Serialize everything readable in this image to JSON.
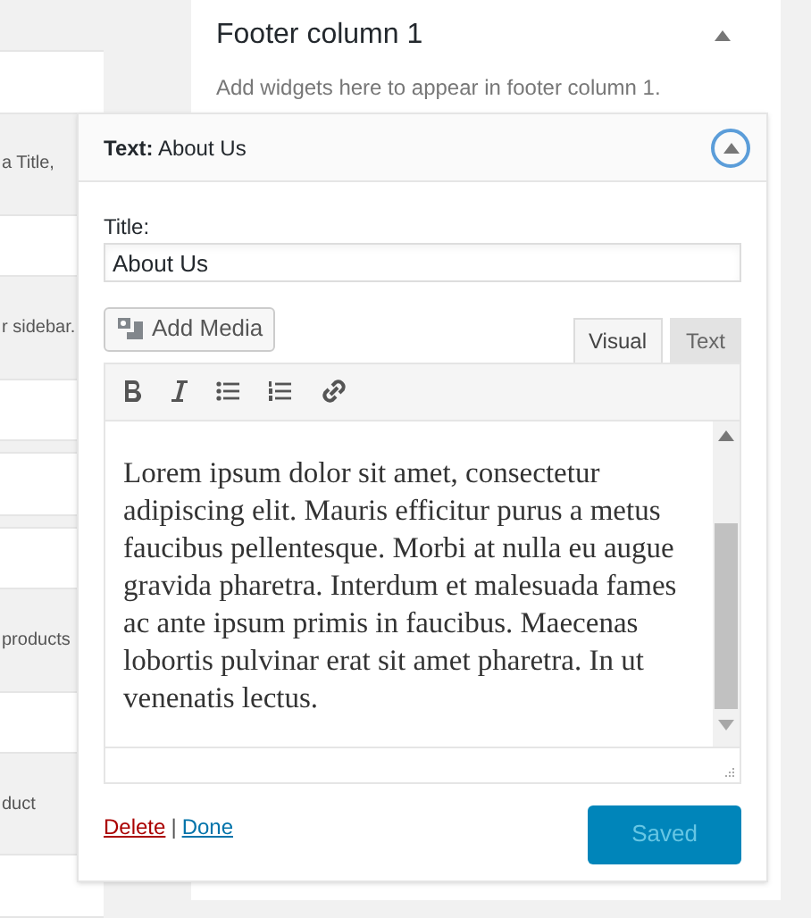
{
  "left_column": {
    "items": [
      {
        "kind": "blank"
      },
      {
        "kind": "text",
        "text": "a Title,"
      },
      {
        "kind": "blank"
      },
      {
        "kind": "text",
        "text": "r sidebar."
      },
      {
        "kind": "blank"
      },
      {
        "kind": "blank"
      },
      {
        "kind": "blank"
      },
      {
        "kind": "text",
        "text": "products"
      },
      {
        "kind": "blank"
      },
      {
        "kind": "text",
        "text": "duct"
      },
      {
        "kind": "blank"
      }
    ]
  },
  "sidebar_panel": {
    "title": "Footer column 1",
    "description": "Add widgets here to appear in footer column 1.",
    "expanded": true
  },
  "widget": {
    "title": "**Text:** About Us",
    "expanded": true,
    "title_label": "Title:",
    "title_value": "About Us",
    "add_media": "Add Media",
    "tabs": [
      {
        "label": "Visual",
        "selected": true
      },
      {
        "label": "Text",
        "selected": false
      }
    ],
    "content": "Lorem ipsum dolor sit amet, consectetur adipiscing elit. Mauris efficitur purus a metus faucibus pellentesque. Morbi at nulla eu augue gravida pharetra. Interdum et malesuada fames ac ante ipsum primis in faucibus. Maecenas lobortis pulvinar erat sit amet pharetra. In ut venenatis lectus.",
    "delete_link": "Delete",
    "separator": "|",
    "done_link": "Done",
    "save_button": {
      "label": "Saved",
      "disabled": true
    }
  }
}
